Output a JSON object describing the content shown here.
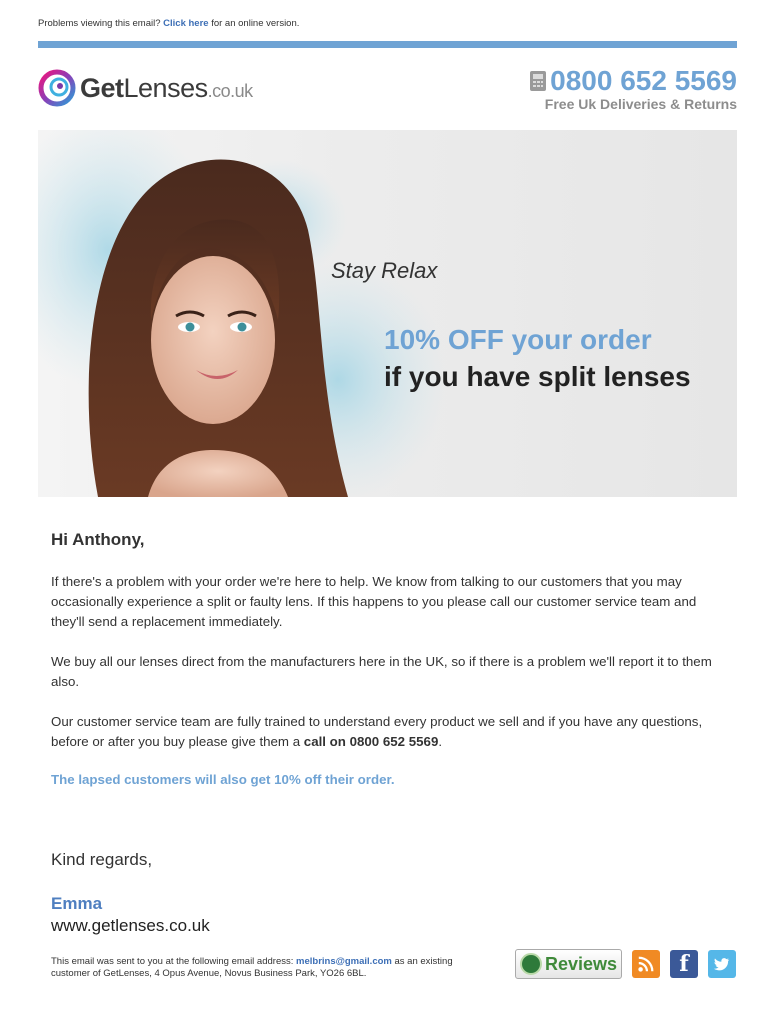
{
  "header": {
    "problems_text": "Problems viewing this email?",
    "click_here": "Click here",
    "online_version": "for an online version."
  },
  "brand": {
    "name_bold": "Get",
    "name_rest": "Lenses",
    "tld": ".co.uk",
    "phone": "0800 652 5569",
    "phone_sub": "Free Uk Deliveries & Returns",
    "accent_color": "#6fa3d4"
  },
  "hero": {
    "tagline": "Stay Relax",
    "offer": "10% OFF your order",
    "offer_sub": "if you have split lenses"
  },
  "body": {
    "greeting": "Hi Anthony,",
    "p1": "If there's a problem with your order we're here to help. We know from talking to our customers that you may occasionally experience a split or faulty lens. If this happens to you please call our customer service team and they'll send a replacement immediately.",
    "p2": "We buy all our lenses direct from the manufacturers here in the UK, so if there is a problem we'll report it to them also.",
    "p3_start": "Our customer service team are fully trained to understand every product we sell and if you have any questions, before or after you buy please give them a ",
    "p3_bold": "call on 0800 652 5569",
    "p3_end": ".",
    "promo": "The lapsed customers will also get 10% off their order."
  },
  "signoff": {
    "regards": "Kind regards,",
    "name": "Emma",
    "website": "www.getlenses.co.uk"
  },
  "footer": {
    "text_start": "This email was sent to you at the following email address: ",
    "email": "melbrins@gmail.com",
    "text_end": " as an existing customer of GetLenses, 4 Opus Avenue, Novus Business Park, YO26 6BL.",
    "reviews_label": "Reviews",
    "social": [
      "rss-icon",
      "facebook-icon",
      "twitter-icon"
    ]
  }
}
